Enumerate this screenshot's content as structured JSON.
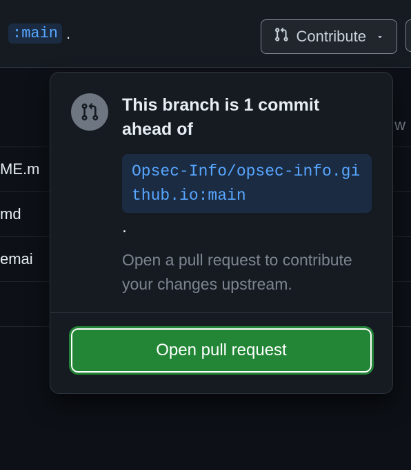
{
  "topbar": {
    "branch_ref_partial": ":main",
    "dot": ".",
    "contribute_label": "Contribute"
  },
  "files": {
    "row1_right": "w",
    "row2": "ME.m",
    "row3": "md",
    "row4": "emai"
  },
  "popover": {
    "heading": "This branch is 1 commit ahead of",
    "upstream_ref": "Opsec-Info/opsec-info.github.io:main",
    "period": ".",
    "helper": "Open a pull request to contribute your changes upstream.",
    "open_pr_label": "Open pull request"
  }
}
